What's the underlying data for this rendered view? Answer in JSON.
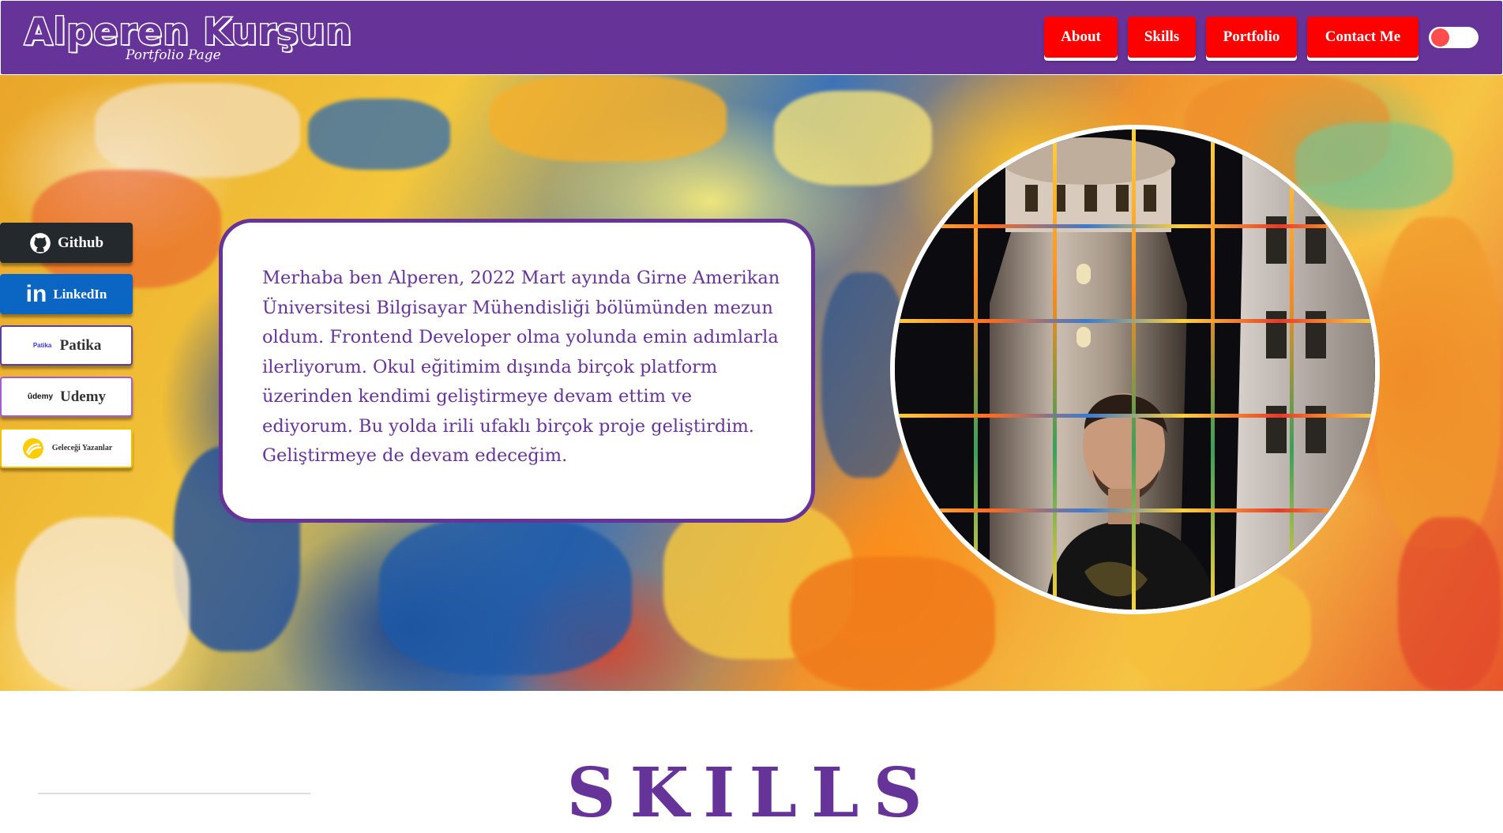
{
  "header": {
    "brand_name": "Alperen Kurşun",
    "brand_subtitle": "Portfolio Page",
    "background_color": "#663399",
    "nav": [
      {
        "label": "About"
      },
      {
        "label": "Skills"
      },
      {
        "label": "Portfolio"
      },
      {
        "label": "Contact Me"
      }
    ],
    "nav_button_color": "#ff0000",
    "theme_toggle": {
      "state": "off",
      "knob_color": "#ff4d4d"
    }
  },
  "social": [
    {
      "label": "Github",
      "icon": "github-icon",
      "bg": "#24292e",
      "fg": "#ffffff"
    },
    {
      "label": "LinkedIn",
      "icon": "linkedin-icon",
      "bg": "#0a66c2",
      "fg": "#ffffff"
    },
    {
      "label": "Patika",
      "icon": "patika-logo",
      "bg": "#ffffff",
      "fg": "#333333",
      "logo_text": "Patika"
    },
    {
      "label": "Udemy",
      "icon": "udemy-logo",
      "bg": "#ffffff",
      "fg": "#333333",
      "logo_text": "ûdemy"
    },
    {
      "label": "Geleceği Yazanlar",
      "icon": "gelecegi-yazanlar-logo",
      "bg": "#ffffff",
      "fg": "#333333"
    }
  ],
  "about": {
    "text": "Merhaba ben Alperen, 2022 Mart ayında Girne Amerikan Üniversitesi Bilgisayar Mühendisliği bölümünden mezun oldum. Frontend Developer olma yolunda emin adımlarla ilerliyorum. Okul eğitimim dışında birçok platform üzerinden kendimi geliştirmeye devam ettim ve ediyorum. Bu yolda irili ufaklı birçok proje geliştirdim. Geliştirmeye de devam edeceğim."
  },
  "portrait": {
    "subject": "profile-photo"
  },
  "skills": {
    "title": "SKILLS"
  }
}
